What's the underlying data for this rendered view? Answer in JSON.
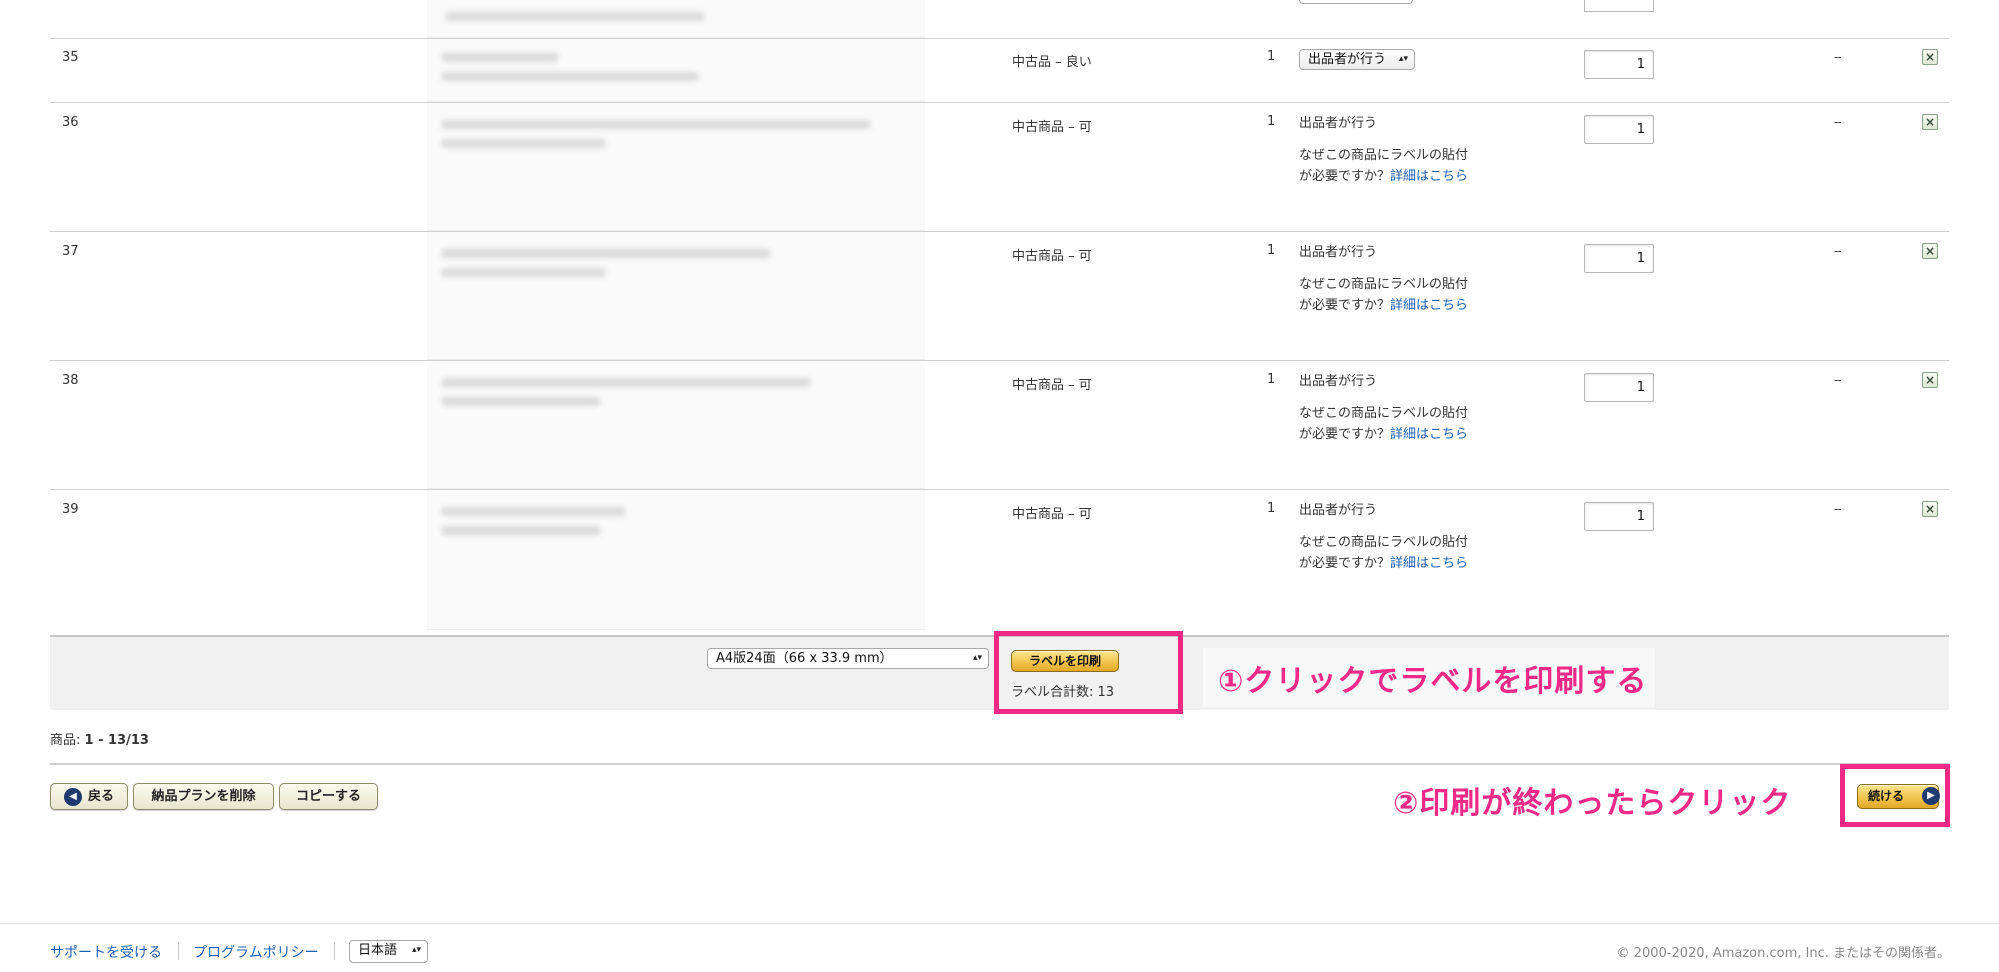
{
  "rows": [
    {
      "num": "35",
      "condition": "中古品 – 良い",
      "qty": "1",
      "prep_select": "出品者が行う",
      "box_qty": "1",
      "fee": "--"
    },
    {
      "num": "36",
      "condition": "中古商品 – 可",
      "qty": "1",
      "prep": "出品者が行う",
      "prep_question": "なぜこの商品にラベルの貼付が必要ですか？",
      "prep_link": "詳細はこちら",
      "box_qty": "1",
      "fee": "--"
    },
    {
      "num": "37",
      "condition": "中古商品 – 可",
      "qty": "1",
      "prep": "出品者が行う",
      "prep_question": "なぜこの商品にラベルの貼付が必要ですか？",
      "prep_link": "詳細はこちら",
      "box_qty": "1",
      "fee": "--"
    },
    {
      "num": "38",
      "condition": "中古商品 – 可",
      "qty": "1",
      "prep": "出品者が行う",
      "prep_question": "なぜこの商品にラベルの貼付が必要ですか？",
      "prep_link": "詳細はこちら",
      "box_qty": "1",
      "fee": "--"
    },
    {
      "num": "39",
      "condition": "中古商品 – 可",
      "qty": "1",
      "prep": "出品者が行う",
      "prep_question": "なぜこの商品にラベルの貼付が必要ですか？",
      "prep_link": "詳細はこちら",
      "box_qty": "1",
      "fee": "--"
    }
  ],
  "label_print": {
    "paper_select": "A4版24面（66 x 33.9 mm）",
    "print_button": "ラベルを印刷",
    "total_label": "ラベル合計数: 13"
  },
  "annotations": {
    "step1": "①クリックでラベルを印刷する",
    "step2": "②印刷が終わったらクリック"
  },
  "pager": {
    "prefix": "商品: ",
    "range": "1 - 13/13"
  },
  "actions": {
    "back": "戻る",
    "delete_plan": "納品プランを削除",
    "copy": "コピーする",
    "continue": "続ける"
  },
  "footer": {
    "support": "サポートを受ける",
    "policy": "プログラムポリシー",
    "language": "日本語",
    "copyright": "© 2000-2020, Amazon.com, Inc. またはその関係者。"
  },
  "colors": {
    "highlight": "#ee2a86",
    "link": "#1d5fb0",
    "button_yellow": "#f0c14b"
  }
}
